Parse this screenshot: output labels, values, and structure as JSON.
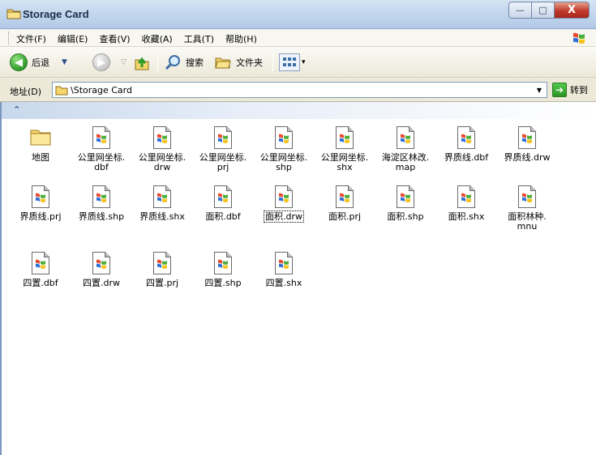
{
  "window": {
    "title": "Storage Card",
    "minimize_symbol": "—",
    "maximize_symbol": "□",
    "close_symbol": "X"
  },
  "menu": {
    "items": [
      "文件(F)",
      "编辑(E)",
      "查看(V)",
      "收藏(A)",
      "工具(T)",
      "帮助(H)"
    ]
  },
  "toolbar": {
    "back_label": "后退",
    "search_label": "搜索",
    "folders_label": "文件夹"
  },
  "address": {
    "label": "地址(D)",
    "path": "\\Storage Card",
    "go_label": "转到"
  },
  "files": [
    {
      "name": "地图",
      "type": "folder"
    },
    {
      "name": "公里网坐标.dbf",
      "type": "file"
    },
    {
      "name": "公里网坐标.drw",
      "type": "file"
    },
    {
      "name": "公里网坐标.prj",
      "type": "file"
    },
    {
      "name": "公里网坐标.shp",
      "type": "file"
    },
    {
      "name": "公里网坐标.shx",
      "type": "file"
    },
    {
      "name": "海淀区林改.map",
      "type": "file"
    },
    {
      "name": "界质线.dbf",
      "type": "file"
    },
    {
      "name": "界质线.drw",
      "type": "file"
    },
    {
      "name": "界质线.prj",
      "type": "file"
    },
    {
      "name": "界质线.shp",
      "type": "file"
    },
    {
      "name": "界质线.shx",
      "type": "file"
    },
    {
      "name": "面积.dbf",
      "type": "file"
    },
    {
      "name": "面积.drw",
      "type": "file",
      "focused": true
    },
    {
      "name": "面积.prj",
      "type": "file"
    },
    {
      "name": "面积.shp",
      "type": "file"
    },
    {
      "name": "面积.shx",
      "type": "file"
    },
    {
      "name": "面积林种.mnu",
      "type": "file"
    },
    {
      "name": "四置.dbf",
      "type": "file"
    },
    {
      "name": "四置.drw",
      "type": "file"
    },
    {
      "name": "四置.prj",
      "type": "file"
    },
    {
      "name": "四置.shp",
      "type": "file"
    },
    {
      "name": "四置.shx",
      "type": "file"
    }
  ],
  "file_label_lines": {
    "公里网坐标.dbf": [
      "公里网坐标.",
      "dbf"
    ],
    "公里网坐标.drw": [
      "公里网坐标.",
      "drw"
    ],
    "公里网坐标.prj": [
      "公里网坐标.",
      "prj"
    ],
    "公里网坐标.shp": [
      "公里网坐标.",
      "shp"
    ],
    "公里网坐标.shx": [
      "公里网坐标.",
      "shx"
    ],
    "海淀区林改.map": [
      "海淀区林改.",
      "map"
    ],
    "面积林种.mnu": [
      "面积林种.",
      "mnu"
    ]
  },
  "colors": {
    "titlebar": "#c4d7ee",
    "toolbar": "#ece9d8",
    "accent_green": "#2f9c2a",
    "close_red": "#c0392b"
  },
  "icons": {
    "title": "folder-icon",
    "back": "back-arrow-icon",
    "forward": "forward-arrow-icon",
    "up": "up-folder-icon",
    "search": "search-icon",
    "folders": "folders-icon",
    "views": "views-icon",
    "go": "go-arrow-icon",
    "file": "windows-document-icon",
    "group_toggle": "chevron-up-icon"
  }
}
